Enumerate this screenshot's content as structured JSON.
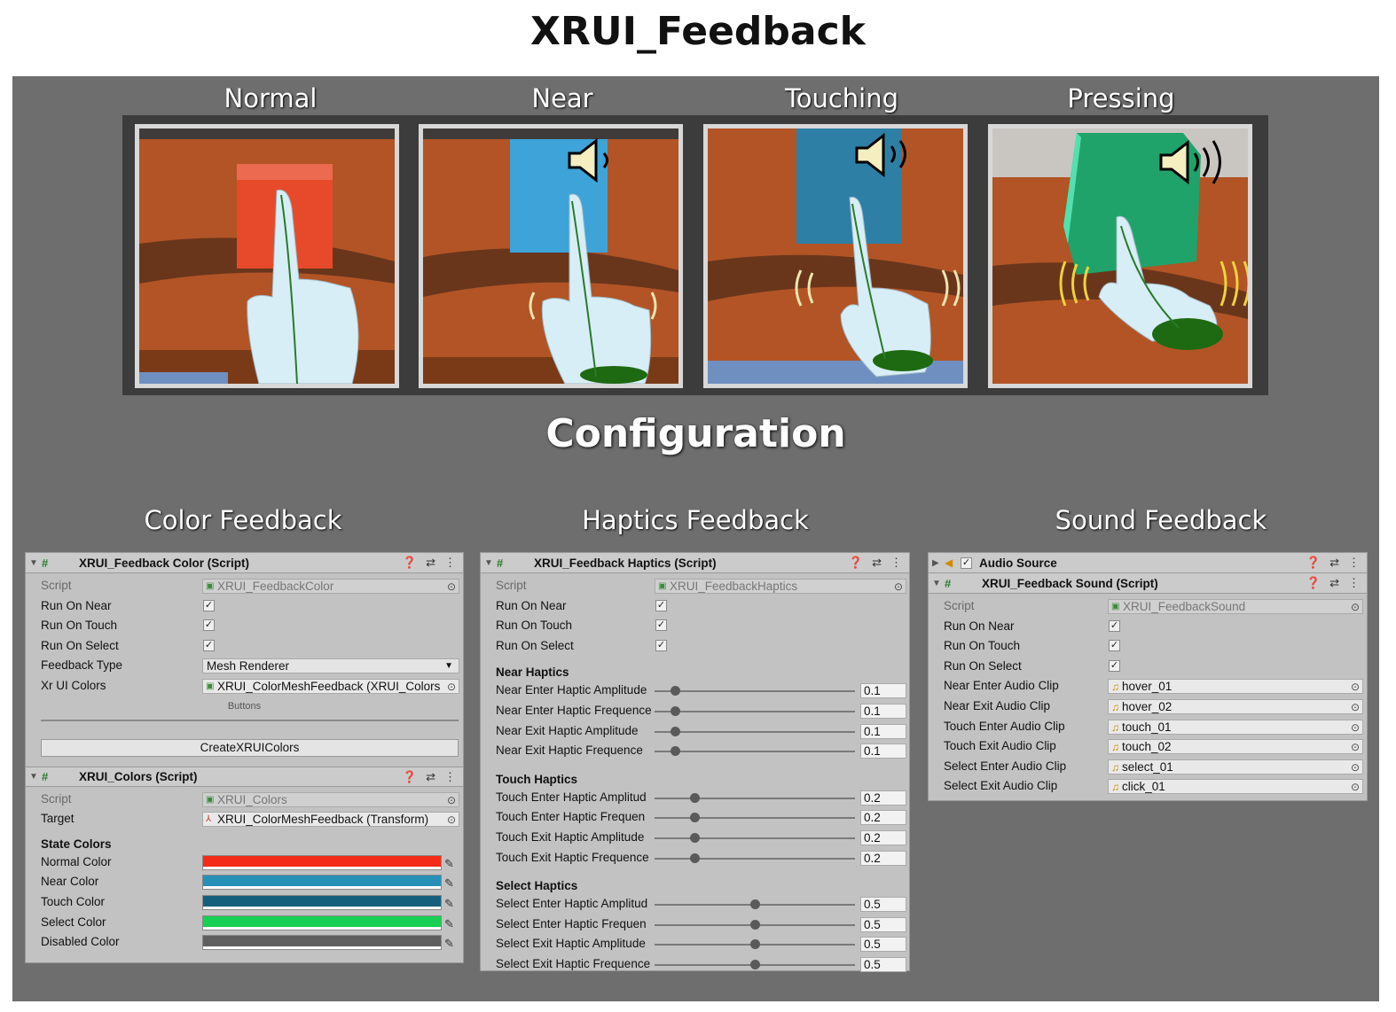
{
  "title": "XRUI_Feedback",
  "states": [
    {
      "label": "Normal",
      "cube_color": "#e74a2a"
    },
    {
      "label": "Near",
      "cube_color": "#3da3d8"
    },
    {
      "label": "Touching",
      "cube_color": "#2e7fa6"
    },
    {
      "label": "Pressing",
      "cube_color": "#1fa36a"
    }
  ],
  "config_title": "Configuration",
  "sections": {
    "color": "Color Feedback",
    "haptics": "Haptics Feedback",
    "sound": "Sound Feedback"
  },
  "color_panel": {
    "header": "XRUI_Feedback Color (Script)",
    "script_label": "Script",
    "script_value": "XRUI_FeedbackColor",
    "run_on_near": "Run On Near",
    "run_on_touch": "Run On Touch",
    "run_on_select": "Run On Select",
    "feedback_type_label": "Feedback Type",
    "feedback_type_value": "Mesh Renderer",
    "colors_label": "Xr UI Colors",
    "colors_value": "XRUI_ColorMeshFeedback (XRUI_Colors",
    "buttons_caption": "Buttons",
    "create_button": "CreateXRUIColors"
  },
  "colors_panel": {
    "header": "XRUI_Colors (Script)",
    "script_label": "Script",
    "script_value": "XRUI_Colors",
    "target_label": "Target",
    "target_value": "XRUI_ColorMeshFeedback (Transform)",
    "state_colors_heading": "State Colors",
    "colors": [
      {
        "label": "Normal Color",
        "hex": "#f42b18"
      },
      {
        "label": "Near Color",
        "hex": "#2790b8"
      },
      {
        "label": "Touch Color",
        "hex": "#14607c"
      },
      {
        "label": "Select Color",
        "hex": "#17cf52"
      },
      {
        "label": "Disabled Color",
        "hex": "#5f5f5f"
      }
    ]
  },
  "haptics_panel": {
    "header": "XRUI_Feedback Haptics (Script)",
    "script_label": "Script",
    "script_value": "XRUI_FeedbackHaptics",
    "run_on_near": "Run On Near",
    "run_on_touch": "Run On Touch",
    "run_on_select": "Run On Select",
    "groups": [
      {
        "heading": "Near Haptics",
        "rows": [
          {
            "label": "Near Enter Haptic Amplitude",
            "value": "0.1",
            "fraction": 0.1
          },
          {
            "label": "Near Enter Haptic Frequence",
            "value": "0.1",
            "fraction": 0.1
          },
          {
            "label": "Near Exit Haptic Amplitude",
            "value": "0.1",
            "fraction": 0.1
          },
          {
            "label": "Near Exit Haptic Frequence",
            "value": "0.1",
            "fraction": 0.1
          }
        ]
      },
      {
        "heading": "Touch Haptics",
        "rows": [
          {
            "label": "Touch Enter Haptic Amplitud",
            "value": "0.2",
            "fraction": 0.2
          },
          {
            "label": "Touch Enter Haptic Frequen",
            "value": "0.2",
            "fraction": 0.2
          },
          {
            "label": "Touch Exit Haptic Amplitude",
            "value": "0.2",
            "fraction": 0.2
          },
          {
            "label": "Touch Exit Haptic Frequence",
            "value": "0.2",
            "fraction": 0.2
          }
        ]
      },
      {
        "heading": "Select Haptics",
        "rows": [
          {
            "label": "Select Enter Haptic Amplitud",
            "value": "0.5",
            "fraction": 0.5
          },
          {
            "label": "Select Enter Haptic Frequen",
            "value": "0.5",
            "fraction": 0.5
          },
          {
            "label": "Select Exit Haptic Amplitude",
            "value": "0.5",
            "fraction": 0.5
          },
          {
            "label": "Select Exit Haptic Frequence",
            "value": "0.5",
            "fraction": 0.5
          }
        ]
      }
    ]
  },
  "sound_panel": {
    "audio_source_header": "Audio Source",
    "header": "XRUI_Feedback Sound (Script)",
    "script_label": "Script",
    "script_value": "XRUI_FeedbackSound",
    "run_on_near": "Run On Near",
    "run_on_touch": "Run On Touch",
    "run_on_select": "Run On Select",
    "clips": [
      {
        "label": "Near Enter Audio Clip",
        "value": "hover_01"
      },
      {
        "label": "Near Exit Audio Clip",
        "value": "hover_02"
      },
      {
        "label": "Touch Enter Audio Clip",
        "value": "touch_01"
      },
      {
        "label": "Touch Exit Audio Clip",
        "value": "touch_02"
      },
      {
        "label": "Select Enter Audio Clip",
        "value": "select_01"
      },
      {
        "label": "Select Exit Audio Clip",
        "value": "click_01"
      }
    ]
  }
}
